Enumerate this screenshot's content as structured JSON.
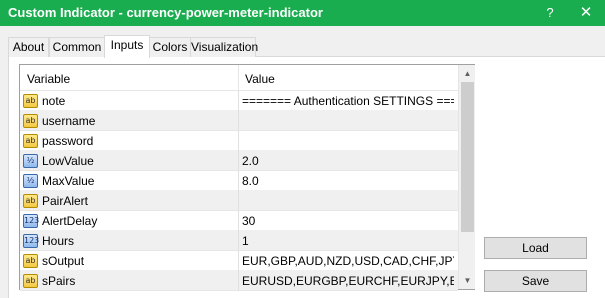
{
  "window": {
    "title": "Custom Indicator - currency-power-meter-indicator",
    "help_label": "?",
    "close_label": "✕",
    "accent_color": "#1aad4f"
  },
  "tabs": [
    {
      "label": "About"
    },
    {
      "label": "Common"
    },
    {
      "label": "Inputs",
      "active": true
    },
    {
      "label": "Colors"
    },
    {
      "label": "Visualization"
    }
  ],
  "grid": {
    "columns": {
      "variable": "Variable",
      "value": "Value"
    },
    "rows": [
      {
        "icon": "ab",
        "type": "text",
        "name": "note",
        "value": "======= Authentication SETTINGS ===..."
      },
      {
        "icon": "ab",
        "type": "text",
        "name": "username",
        "value": ""
      },
      {
        "icon": "ab",
        "type": "text",
        "name": "password",
        "value": ""
      },
      {
        "icon": "½",
        "type": "double",
        "name": "LowValue",
        "value": "2.0"
      },
      {
        "icon": "½",
        "type": "double",
        "name": "MaxValue",
        "value": "8.0"
      },
      {
        "icon": "ab",
        "type": "text",
        "name": "PairAlert",
        "value": ""
      },
      {
        "icon": "123",
        "type": "int",
        "name": "AlertDelay",
        "value": "30"
      },
      {
        "icon": "123",
        "type": "int",
        "name": "Hours",
        "value": "1"
      },
      {
        "icon": "ab",
        "type": "text",
        "name": "sOutput",
        "value": "EUR,GBP,AUD,NZD,USD,CAD,CHF,JPY"
      },
      {
        "icon": "ab",
        "type": "text",
        "name": "sPairs",
        "value": "EURUSD,EURGBP,EURCHF,EURJPY,E..."
      }
    ]
  },
  "scrollbar": {
    "up_icon": "▲",
    "down_icon": "▼"
  },
  "buttons": {
    "load_label": "Load",
    "save_label": "Save"
  }
}
